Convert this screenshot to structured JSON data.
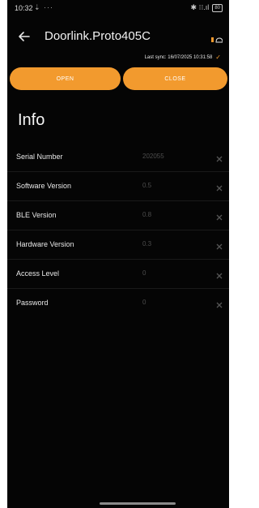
{
  "status": {
    "time": "10:32",
    "extra": "⇣ ···",
    "signal": "✱ ⁝⁝.ıl",
    "battery": "80"
  },
  "header": {
    "title": "Doorlink.Proto405C",
    "last_sync": "Last sync: 16/07/2025 10:31:58"
  },
  "actions": {
    "open_label": "OPEN",
    "close_label": "CLOSE"
  },
  "info": {
    "heading": "Info",
    "rows": [
      {
        "label": "Serial Number",
        "value": "202055"
      },
      {
        "label": "Software Version",
        "value": "0.5"
      },
      {
        "label": "BLE Version",
        "value": "0.8"
      },
      {
        "label": "Hardware Version",
        "value": "0.3"
      },
      {
        "label": "Access Level",
        "value": "0"
      },
      {
        "label": "Password",
        "value": "0"
      }
    ]
  },
  "colors": {
    "accent": "#f29a2e",
    "background": "#050505",
    "value_text": "#4d4d4d"
  },
  "icons": {
    "back": "back-arrow-icon",
    "device": "device-status-icon",
    "sync": "checkmark-icon",
    "clear": "close-icon"
  }
}
